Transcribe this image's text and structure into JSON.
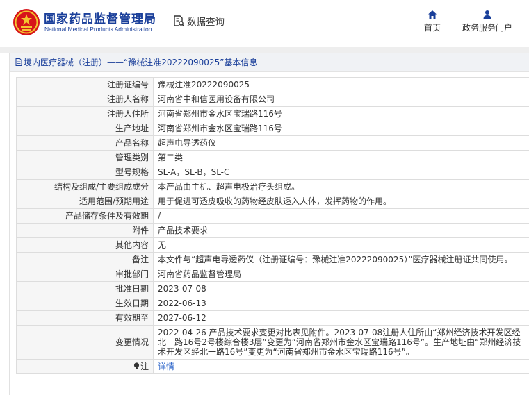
{
  "header": {
    "org_name_cn": "国家药品监督管理局",
    "org_name_en": "National Medical Products Administration",
    "data_query_label": "数据查询",
    "nav": [
      {
        "label": "首页",
        "icon": "home-icon"
      },
      {
        "label": "政务服务门户",
        "icon": "user-icon"
      }
    ]
  },
  "panel": {
    "title": "境内医疗器械（注册）——“豫械注准20222090025”基本信息"
  },
  "record": [
    {
      "label": "注册证编号",
      "value": "豫械注准20222090025"
    },
    {
      "label": "注册人名称",
      "value": "河南省中和信医用设备有限公司"
    },
    {
      "label": "注册人住所",
      "value": "河南省郑州市金水区宝瑞路116号"
    },
    {
      "label": "生产地址",
      "value": "河南省郑州市金水区宝瑞路116号"
    },
    {
      "label": "产品名称",
      "value": "超声电导透药仪"
    },
    {
      "label": "管理类别",
      "value": "第二类"
    },
    {
      "label": "型号规格",
      "value": "SL-A，SL-B，SL-C"
    },
    {
      "label": "结构及组成/主要组成成分",
      "value": "本产品由主机、超声电极治疗头组成。"
    },
    {
      "label": "适用范围/预期用途",
      "value": "用于促进可透皮吸收的药物经皮肤透入人体，发挥药物的作用。"
    },
    {
      "label": "产品储存条件及有效期",
      "value": "/"
    },
    {
      "label": "附件",
      "value": "产品技术要求"
    },
    {
      "label": "其他内容",
      "value": "无"
    },
    {
      "label": "备注",
      "value": "本文件与“超声电导透药仪（注册证编号：豫械注准20222090025）”医疗器械注册证共同使用。"
    },
    {
      "label": "审批部门",
      "value": "河南省药品监督管理局"
    },
    {
      "label": "批准日期",
      "value": "2023-07-08"
    },
    {
      "label": "生效日期",
      "value": "2022-06-13"
    },
    {
      "label": "有效期至",
      "value": "2027-06-12"
    },
    {
      "label": "变更情况",
      "value": "2022-04-26 产品技术要求变更对比表见附件。2023-07-08注册人住所由“郑州经济技术开发区经北一路16号2号楼综合楼3层”变更为“河南省郑州市金水区宝瑞路116号”。生产地址由“郑州经济技术开发区经北一路16号”变更为“河南省郑州市金水区宝瑞路116号”。"
    }
  ],
  "note": {
    "label": "注",
    "link_text": "详情"
  }
}
